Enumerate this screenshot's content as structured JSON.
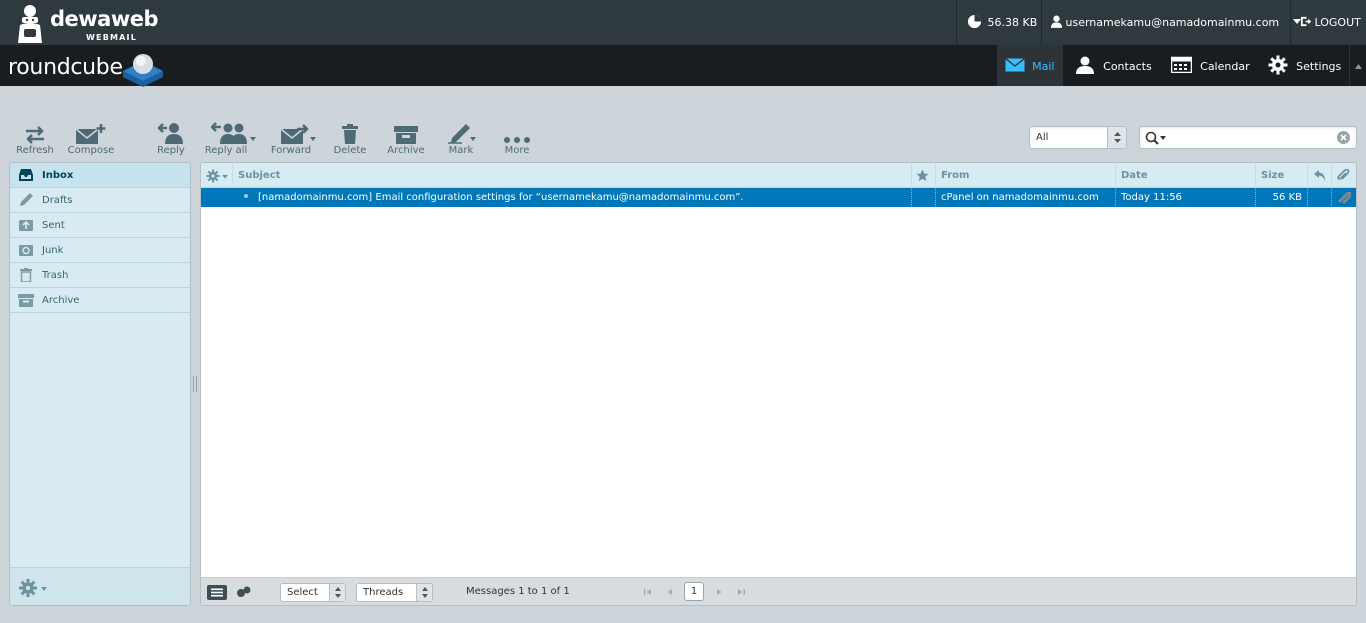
{
  "brand": {
    "name": "dewaweb",
    "subtitle": "WEBMAIL",
    "app": "roundcube"
  },
  "topbar": {
    "quota": "56.38 KB",
    "username": "usernamekamu@namadomainmu.com",
    "logout": "LOGOUT"
  },
  "nav": {
    "mail": "Mail",
    "contacts": "Contacts",
    "calendar": "Calendar",
    "settings": "Settings"
  },
  "toolbar": {
    "refresh": "Refresh",
    "compose": "Compose",
    "reply": "Reply",
    "reply_all": "Reply all",
    "forward": "Forward",
    "delete": "Delete",
    "archive": "Archive",
    "mark": "Mark",
    "more": "More"
  },
  "search": {
    "filter": "All",
    "query": ""
  },
  "folders": [
    {
      "label": "Inbox",
      "icon": "inbox-icon",
      "selected": true
    },
    {
      "label": "Drafts",
      "icon": "pencil-icon"
    },
    {
      "label": "Sent",
      "icon": "sent-icon"
    },
    {
      "label": "Junk",
      "icon": "junk-icon"
    },
    {
      "label": "Trash",
      "icon": "trash-icon"
    },
    {
      "label": "Archive",
      "icon": "archive-icon"
    }
  ],
  "list": {
    "columns": {
      "subject": "Subject",
      "from": "From",
      "date": "Date",
      "size": "Size"
    },
    "messages": [
      {
        "subject": "[namadomainmu.com] Email configuration settings for “usernamekamu@namadomainmu.com”.",
        "from": "cPanel on namadomainmu.com",
        "date": "Today 11:56",
        "size": "56 KB",
        "selected": true,
        "has_attachment": true
      }
    ]
  },
  "footer": {
    "select": "Select",
    "threads": "Threads",
    "count_text": "Messages 1 to 1 of 1",
    "page": "1"
  },
  "colors": {
    "accent": "#37beff",
    "selected_row": "#0077b9",
    "topbar": "#2f3a3f",
    "header": "#191d1f"
  }
}
